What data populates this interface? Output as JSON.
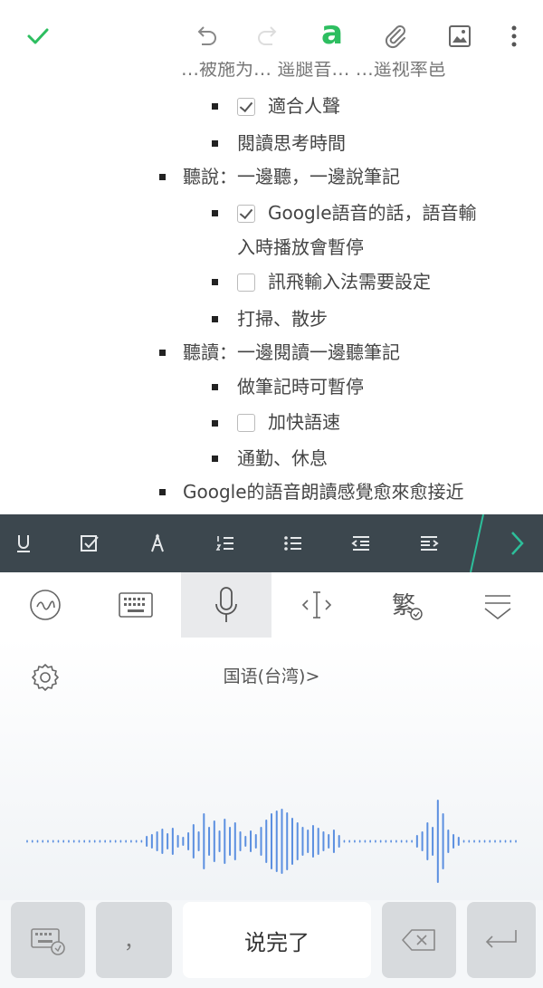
{
  "toolbar": {
    "confirm_icon": "check-icon",
    "undo_icon": "undo-icon",
    "redo_icon": "redo-icon",
    "text_format_label": "a",
    "attach_icon": "paperclip-icon",
    "image_icon": "image-icon",
    "more_icon": "more-vertical-icon",
    "accent_color": "#2dbe60"
  },
  "note": {
    "top_cut_text": "…被施为…  遥腿音…  …遥视率邑",
    "items": [
      {
        "level": 2,
        "type": "checkbox",
        "checked": true,
        "text": "適合人聲"
      },
      {
        "level": 2,
        "type": "bullet",
        "text": "閱讀思考時間"
      },
      {
        "level": 1,
        "type": "bullet",
        "text": "聽說：一邊聽，一邊說筆記"
      },
      {
        "level": 2,
        "type": "checkbox",
        "checked": true,
        "text": "Google語音的話，語音輸",
        "cont": "入時播放會暫停"
      },
      {
        "level": 2,
        "type": "checkbox",
        "checked": false,
        "text": "訊飛輸入法需要設定"
      },
      {
        "level": 2,
        "type": "bullet",
        "text": "打掃、散步"
      },
      {
        "level": 1,
        "type": "bullet",
        "text": "聽讀：一邊閱讀一邊聽筆記"
      },
      {
        "level": 2,
        "type": "bullet",
        "text": "做筆記時可暫停"
      },
      {
        "level": 2,
        "type": "checkbox",
        "checked": false,
        "text": "加快語速"
      },
      {
        "level": 2,
        "type": "bullet",
        "text": "通勤、休息"
      },
      {
        "level": 1,
        "type": "bullet",
        "text": "Google的語音朗讀感覺愈來愈接近"
      }
    ]
  },
  "format_toolbar": {
    "buttons": [
      "underline-icon",
      "checklist-icon",
      "highlight-icon",
      "numbered-list-icon",
      "bulleted-list-icon",
      "outdent-icon",
      "indent-icon"
    ],
    "next_icon": "chevron-right-icon",
    "bg_color": "#3c474e",
    "accent_color": "#2dbe9a"
  },
  "keyboard": {
    "tabs": [
      "handwriting-icon",
      "keyboard-icon",
      "microphone-icon",
      "cursor-icon",
      "traditional-simplified-icon",
      "hide-keyboard-icon"
    ],
    "active_tab": "microphone-icon",
    "language_label": "国语(台湾)>",
    "wave_color": "#5b8fe0",
    "bottom": {
      "switch_keyboard_icon": "keyboard-switch-icon",
      "comma_label": "，",
      "done_label": "说完了",
      "backspace_icon": "backspace-icon",
      "enter_icon": "enter-icon"
    }
  }
}
